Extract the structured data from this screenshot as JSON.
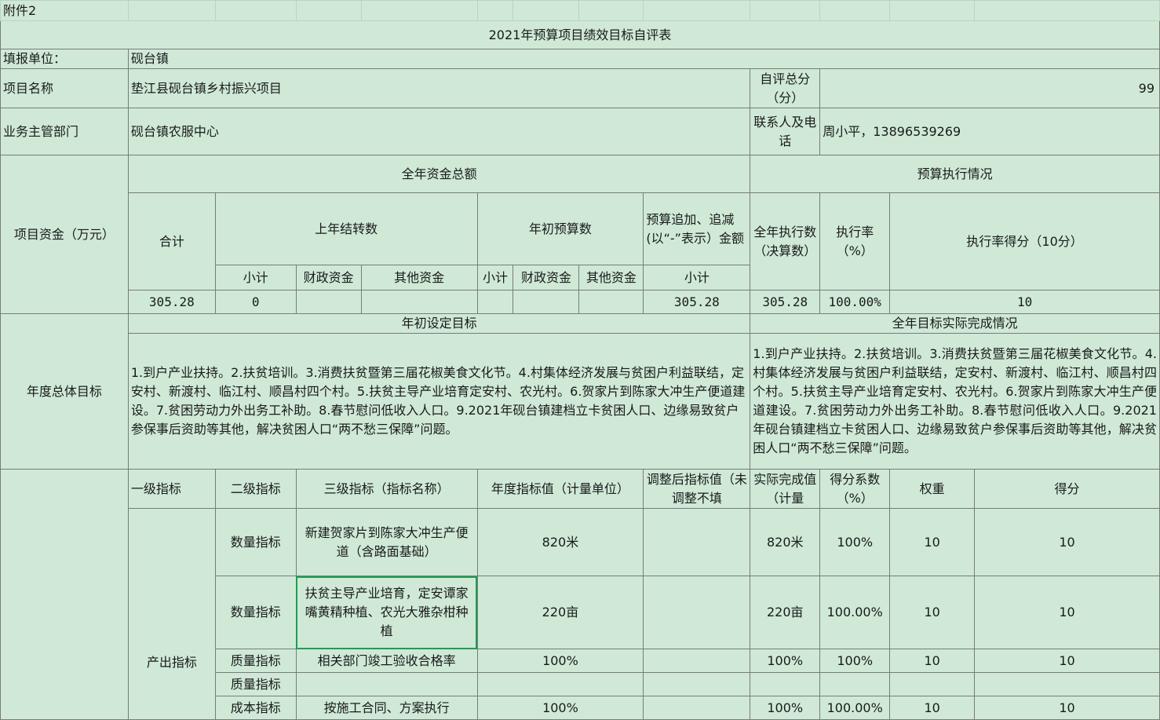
{
  "attachment": "附件2",
  "title": "2021年预算项目绩效目标自评表",
  "unit_label": "填报单位：",
  "unit_value": "砚台镇",
  "project_name_label": "项目名称",
  "project_name_value": "垫江县砚台镇乡村振兴项目",
  "total_score_label": "自评总分（分）",
  "total_score_value": "99",
  "dept_label": "业务主管部门",
  "dept_value": "砚台镇农服中心",
  "contact_label": "联系人及电话",
  "contact_value": "周小平，13896539269",
  "funds": {
    "total_header": "全年资金总额",
    "exec_header": "预算执行情况",
    "row_label": "项目资金（万元）",
    "sum_label": "合计",
    "carry_label": "上年结转数",
    "initial_label": "年初预算数",
    "adjust_label": "预算追加、追减(以“-”表示）金额",
    "exec_amount_label": "全年执行数（决算数）",
    "exec_rate_label": "执行率（%）",
    "exec_score_label": "执行率得分（10分）",
    "sub_labels": {
      "subtotal": "小计",
      "fiscal": "财政资金",
      "other": "其他资金"
    },
    "values": {
      "sum": "305.28",
      "carry_subtotal": "0",
      "carry_fiscal": "",
      "carry_other": "",
      "initial_subtotal": "",
      "initial_fiscal": "",
      "initial_other": "",
      "adjust_subtotal": "305.28",
      "exec_amount": "305.28",
      "exec_rate": "100.00%",
      "exec_score": "10"
    }
  },
  "annual_goal": {
    "row_label": "年度总体目标",
    "set_header": "年初设定目标",
    "actual_header": "全年目标实际完成情况",
    "set_text": "1.到户产业扶持。2.扶贫培训。3.消费扶贫暨第三届花椒美食文化节。4.村集体经济发展与贫困户利益联结，定安村、新渡村、临江村、顺昌村四个村。5.扶贫主导产业培育定安村、农光村。6.贺家片到陈家大冲生产便道建设。7.贫困劳动力外出务工补助。8.春节慰问低收入人口。9.2021年砚台镇建档立卡贫困人口、边缘易致贫户参保事后资助等其他，解决贫困人口“两不愁三保障”问题。",
    "actual_text": "1.到户产业扶持。2.扶贫培训。3.消费扶贫暨第三届花椒美食文化节。4.村集体经济发展与贫困户利益联结，定安村、新渡村、临江村、顺昌村四个村。5.扶贫主导产业培育定安村、农光村。6.贺家片到陈家大冲生产便道建设。7.贫困劳动力外出务工补助。8.春节慰问低收入人口。9.2021年砚台镇建档立卡贫困人口、边缘易致贫户参保事后资助等其他，解决贫困人口“两不愁三保障”问题。"
  },
  "indicators": {
    "headers": {
      "level1": "一级指标",
      "level2": "二级指标",
      "level3": "三级指标（指标名称）",
      "annual_value": "年度指标值（计量单位）",
      "adjusted_value": "调整后指标值（未调整不填",
      "actual_value": "实际完成值（计量",
      "coef": "得分系数（%）",
      "weight": "权重",
      "score": "得分"
    },
    "group_label": "产出指标",
    "rows": [
      {
        "level2": "数量指标",
        "level3": "新建贺家片到陈家大冲生产便道（含路面基础）",
        "annual": "820米",
        "adjusted": "",
        "actual": "820米",
        "coef": "100%",
        "weight": "10",
        "score": "10"
      },
      {
        "level2": "数量指标",
        "level3": "扶贫主导产业培育，定安谭家嘴黄精种植、农光大雅杂柑种植",
        "annual": "220亩",
        "adjusted": "",
        "actual": "220亩",
        "coef": "100.00%",
        "weight": "10",
        "score": "10"
      },
      {
        "level2": "质量指标",
        "level3": "相关部门竣工验收合格率",
        "annual": "100%",
        "adjusted": "",
        "actual": "100%",
        "coef": "100%",
        "weight": "10",
        "score": "10"
      },
      {
        "level2": "质量指标",
        "level3": "",
        "annual": "",
        "adjusted": "",
        "actual": "",
        "coef": "",
        "weight": "",
        "score": ""
      },
      {
        "level2": "成本指标",
        "level3": "按施工合同、方案执行",
        "annual": "100%",
        "adjusted": "",
        "actual": "100%",
        "coef": "100.00%",
        "weight": "10",
        "score": "10"
      }
    ]
  }
}
